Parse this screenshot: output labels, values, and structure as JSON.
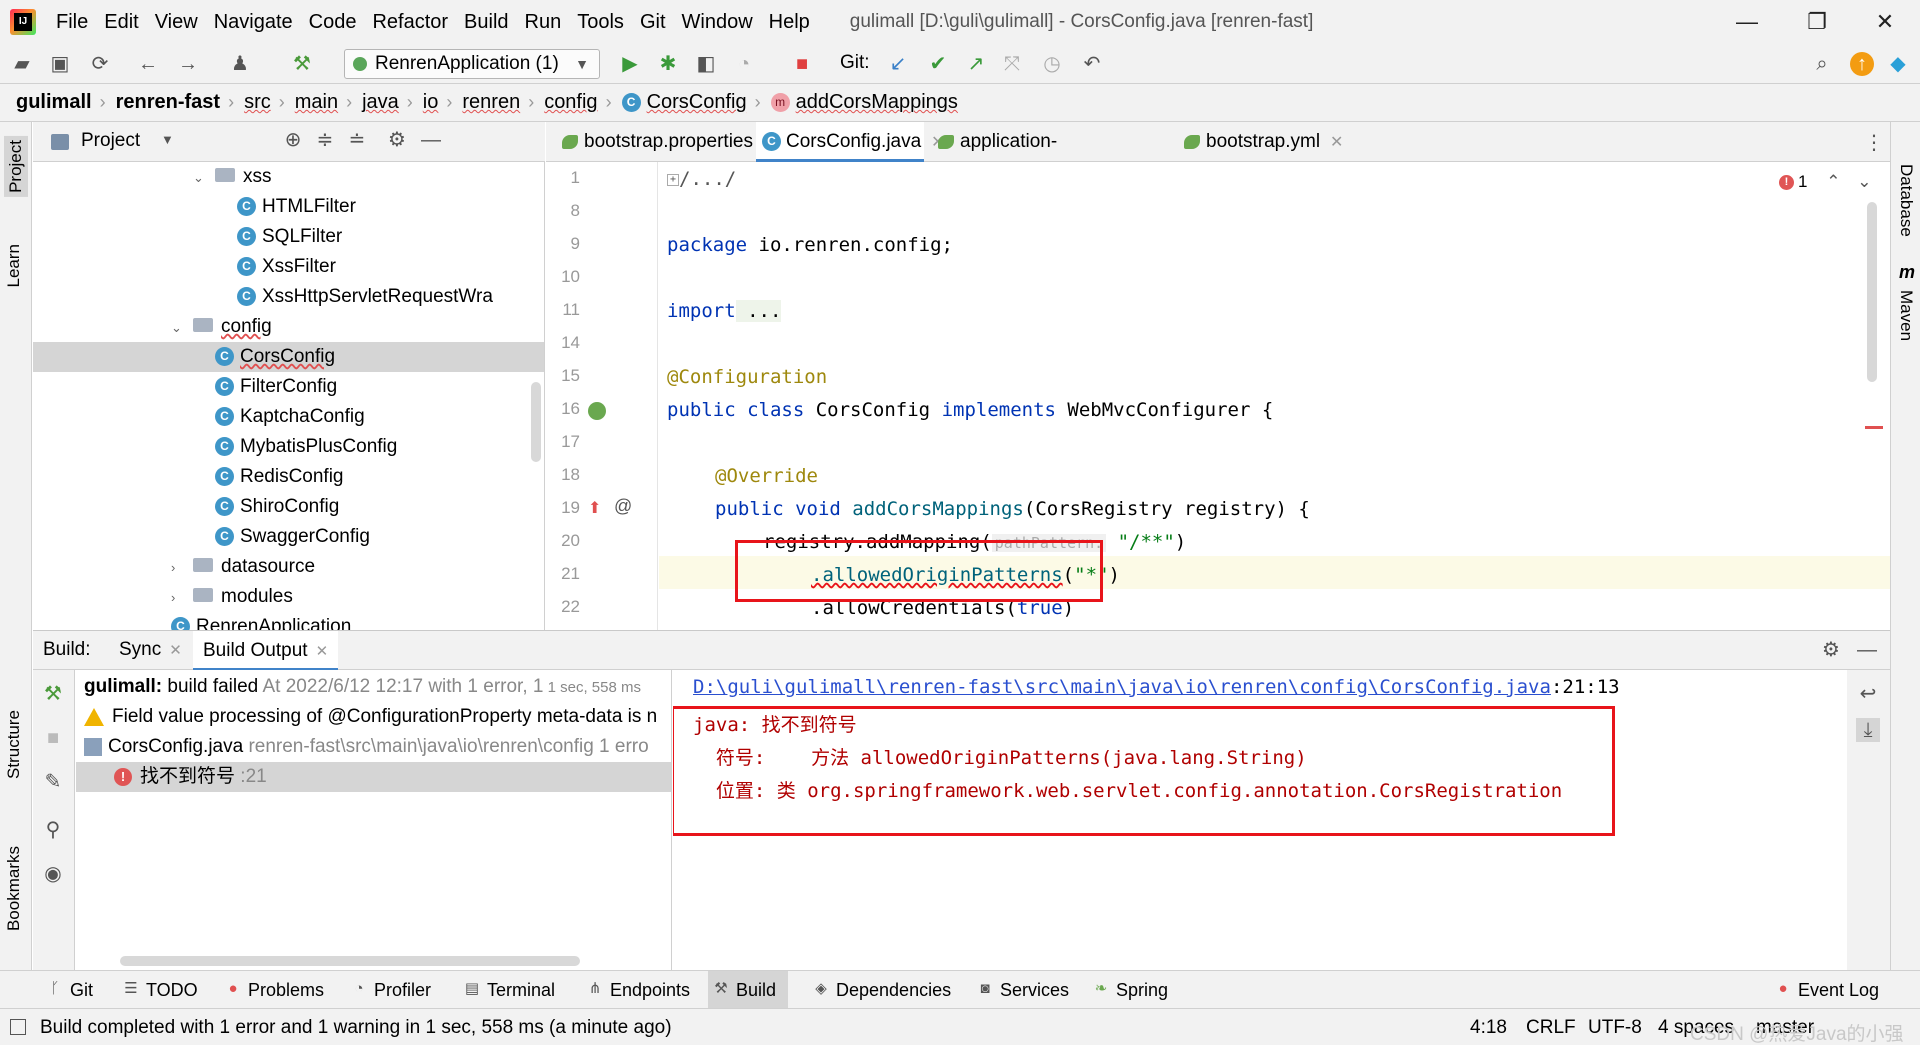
{
  "window": {
    "title": "gulimall [D:\\guli\\gulimall] - CorsConfig.java [renren-fast]",
    "controls": {
      "minimize": "—",
      "restore": "❐",
      "close": "✕"
    }
  },
  "menu": [
    "File",
    "Edit",
    "View",
    "Navigate",
    "Code",
    "Refactor",
    "Build",
    "Run",
    "Tools",
    "Git",
    "Window",
    "Help"
  ],
  "toolbar": {
    "run_config": "RenrenApplication (1)",
    "git_label": "Git:"
  },
  "breadcrumb": [
    "gulimall",
    "renren-fast",
    "src",
    "main",
    "java",
    "io",
    "renren",
    "config",
    "CorsConfig",
    "addCorsMappings"
  ],
  "left_stripe": {
    "project": "Project",
    "learn": "Learn",
    "structure": "Structure",
    "bookmarks": "Bookmarks"
  },
  "right_stripe": {
    "database": "Database",
    "maven": "Maven",
    "maven_icon": "m"
  },
  "project_panel": {
    "title": "Project",
    "tree": [
      {
        "label": "xss",
        "type": "folder",
        "depth": 7,
        "expanded": true
      },
      {
        "label": "HTMLFilter",
        "type": "class",
        "depth": 9
      },
      {
        "label": "SQLFilter",
        "type": "class",
        "depth": 9
      },
      {
        "label": "XssFilter",
        "type": "class",
        "depth": 9
      },
      {
        "label": "XssHttpServletRequestWra",
        "type": "class",
        "depth": 9
      },
      {
        "label": "config",
        "type": "folder",
        "depth": 6,
        "expanded": true
      },
      {
        "label": "CorsConfig",
        "type": "class",
        "depth": 8,
        "selected": true
      },
      {
        "label": "FilterConfig",
        "type": "class",
        "depth": 8
      },
      {
        "label": "KaptchaConfig",
        "type": "class",
        "depth": 8
      },
      {
        "label": "MybatisPlusConfig",
        "type": "class",
        "depth": 8
      },
      {
        "label": "RedisConfig",
        "type": "class",
        "depth": 8
      },
      {
        "label": "ShiroConfig",
        "type": "class",
        "depth": 8
      },
      {
        "label": "SwaggerConfig",
        "type": "class",
        "depth": 8
      },
      {
        "label": "datasource",
        "type": "folder",
        "depth": 6,
        "expanded": false
      },
      {
        "label": "modules",
        "type": "folder",
        "depth": 6,
        "expanded": false
      },
      {
        "label": "RenrenApplication",
        "type": "class",
        "depth": 6
      }
    ]
  },
  "editor_tabs": [
    {
      "label": "bootstrap.properties",
      "active": false
    },
    {
      "label": "CorsConfig.java",
      "active": true
    },
    {
      "label": "application-dev.yml",
      "active": false
    },
    {
      "label": "bootstrap.yml",
      "active": false
    }
  ],
  "inspection": {
    "errors": "1"
  },
  "code": {
    "line_numbers": [
      "1",
      "8",
      "9",
      "10",
      "11",
      "14",
      "15",
      "16",
      "17",
      "18",
      "19",
      "20",
      "21",
      "22"
    ],
    "l1": "/.../",
    "l9_kw": "package",
    "l9_rest": " io.renren.config;",
    "l11_kw": "import",
    "l11_rest": " ...",
    "l15": "@Configuration",
    "l16_kw1": "public class",
    "l16_name": " CorsConfig ",
    "l16_kw2": "implements",
    "l16_rest": " WebMvcConfigurer {",
    "l18": "@Override",
    "l19_kw": "public void",
    "l19_method": " addCorsMappings",
    "l19_rest": "(CorsRegistry registry) {",
    "l20_a": "registry.addMapping(",
    "l20_hint": "pathPattern:",
    "l20_str": " \"/**\"",
    "l20_b": ")",
    "l21_a": ".allowedOriginPatterns",
    "l21_b": "(",
    "l21_str": "\"*\"",
    "l21_c": ")",
    "l22_a": ".allowCredentials(",
    "l22_kw": "true",
    "l22_b": ")"
  },
  "build": {
    "label": "Build:",
    "tabs": [
      "Sync",
      "Build Output"
    ],
    "tree": {
      "root_bold": "gulimall:",
      "root_status": " build failed",
      "root_time": " At 2022/6/12 12:17 with 1 error, 1",
      "root_dur": " 1 sec, 558 ms",
      "warning": "Field value processing of @ConfigurationProperty meta-data is n",
      "file": "CorsConfig.java",
      "file_path": " renren-fast\\src\\main\\java\\io\\renren\\config 1 erro",
      "error": "找不到符号",
      "error_loc": " :21"
    },
    "output": {
      "path": "D:\\guli\\gulimall\\renren-fast\\src\\main\\java\\io\\renren\\config\\CorsConfig.java",
      "path_loc": ":21:13",
      "line1_a": "java: ",
      "line1_b": "找不到符号",
      "line2_a": "  符号:    方法 ",
      "line2_b": "allowedOriginPatterns(java.lang.String)",
      "line3_a": "  位置: 类 ",
      "line3_b": "org.springframework.web.servlet.config.annotation.CorsRegistration"
    }
  },
  "tool_windows": [
    {
      "label": "Git",
      "icon": "branch-icon"
    },
    {
      "label": "TODO",
      "icon": "list-icon"
    },
    {
      "label": "Problems",
      "icon": "problems-icon"
    },
    {
      "label": "Profiler",
      "icon": "profiler-icon"
    },
    {
      "label": "Terminal",
      "icon": "terminal-icon"
    },
    {
      "label": "Endpoints",
      "icon": "endpoints-icon"
    },
    {
      "label": "Build",
      "icon": "hammer-icon",
      "active": true
    },
    {
      "label": "Dependencies",
      "icon": "dependencies-icon"
    },
    {
      "label": "Services",
      "icon": "services-icon"
    },
    {
      "label": "Spring",
      "icon": "spring-icon"
    },
    {
      "label": "Event Log",
      "icon": "event-log-icon"
    }
  ],
  "status": {
    "message": "Build completed with 1 error and 1 warning in 1 sec, 558 ms (a minute ago)",
    "position": "4:18",
    "line_sep": "CRLF",
    "encoding": "UTF-8",
    "indent": "4 spaces",
    "branch": "master",
    "watermark": "CSDN @热爱Java的小强"
  },
  "colors": {
    "accent": "#4083c9",
    "error": "#e8141a",
    "keyword": "#0033b3",
    "annotation": "#9e880d",
    "string": "#067d17"
  }
}
